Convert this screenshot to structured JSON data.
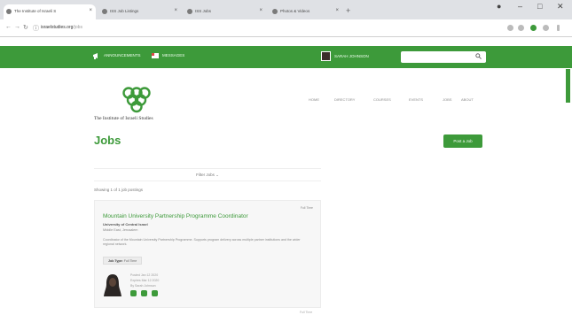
{
  "browser": {
    "tabs": [
      {
        "label": "The Institute of Israeli S"
      },
      {
        "label": "ISS Job Listings"
      },
      {
        "label": "ISS Jobs"
      },
      {
        "label": "Photos & Videos"
      }
    ],
    "url_host": "israelstudies.org",
    "url_path": "/jobs"
  },
  "topnav": {
    "announcements_label": "ANNOUNCEMENTS",
    "messages_label": "MESSAGES",
    "username": "SARAH JOHNSON",
    "search_placeholder": ""
  },
  "site": {
    "brand_name": "The Institute of Israeli Studies",
    "nav_items": [
      "HOME",
      "DIRECTORY",
      "COURSES",
      "EVENTS",
      "JOBS",
      "ABOUT"
    ]
  },
  "page": {
    "title": "Jobs",
    "post_button_label": "Post a Job",
    "filter_label": "Filter Jobs",
    "showing_text": "Showing 1 of 1 job postings"
  },
  "job": {
    "badge": "Full Time",
    "title": "Mountain University Partnership Programme Coordinator",
    "organization": "University of Central Israel",
    "location": "Middle East, Jerusalem",
    "description": "Coordinator of the Mountain University Partnership Programme. Supports program delivery across multiple partner institutions and the wider regional network.",
    "job_type_label": "Job Type:",
    "job_type_value": "Full Time",
    "posted": "Posted Jan 12 2020",
    "expires": "Expires Mar 12 2020",
    "by": "By Sarah Johnson"
  },
  "footer": {
    "tag": "Full Time"
  },
  "colors": {
    "brand_green": "#3d9a3a"
  }
}
